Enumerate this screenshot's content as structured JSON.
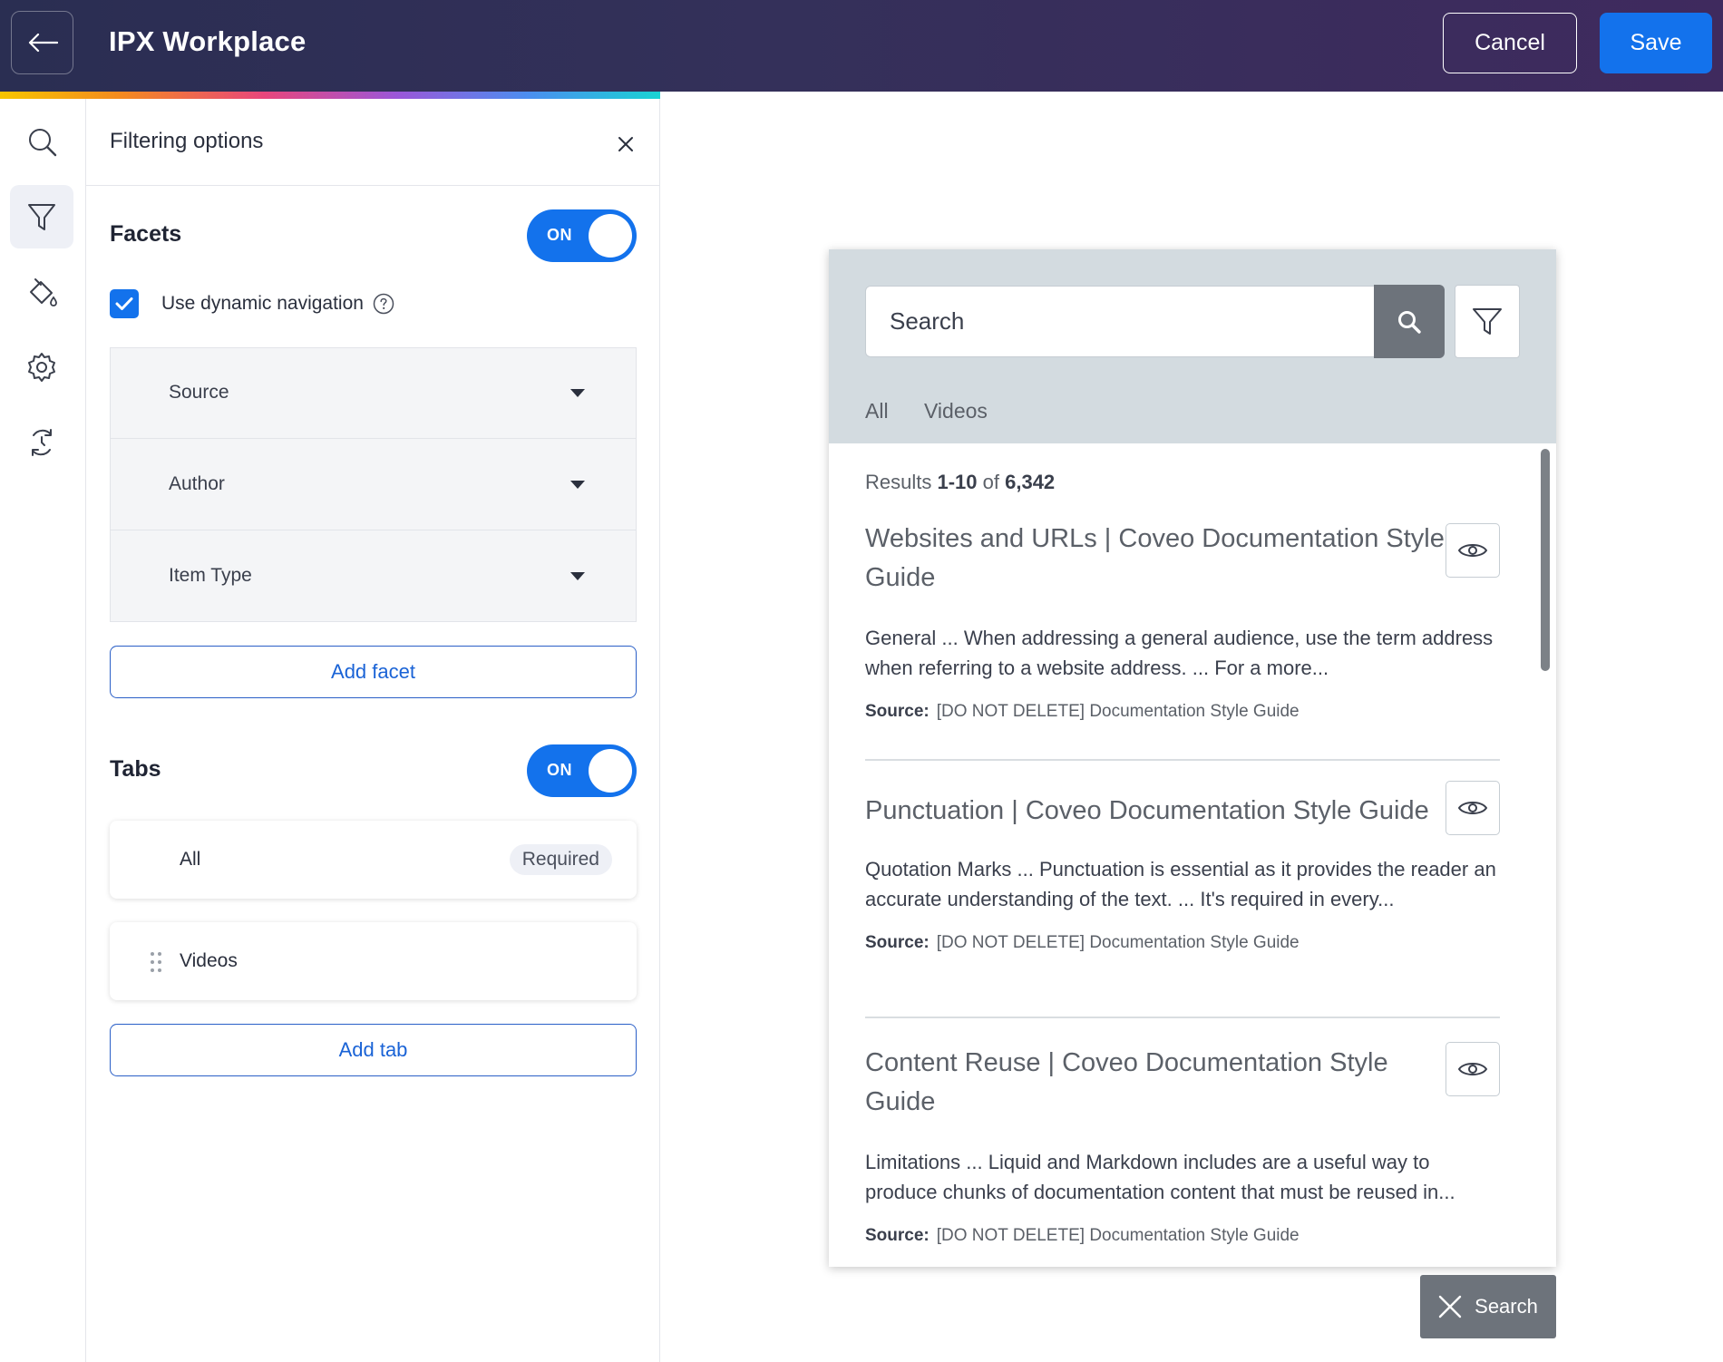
{
  "header": {
    "title": "IPX Workplace",
    "cancel_label": "Cancel",
    "save_label": "Save"
  },
  "colors": {
    "header_bg": "#2a2e52",
    "accent": "#1372ec",
    "preview_header_bg": "#d3dbe0",
    "preview_button_bg": "#6d737b"
  },
  "rail": {
    "items": [
      {
        "icon": "search-icon",
        "active": false
      },
      {
        "icon": "filter-icon",
        "active": true
      },
      {
        "icon": "paint-bucket-icon",
        "active": false
      },
      {
        "icon": "gear-icon",
        "active": false
      },
      {
        "icon": "sync-icon",
        "active": false
      }
    ]
  },
  "panel": {
    "title": "Filtering options",
    "facets": {
      "label": "Facets",
      "toggle_label": "ON",
      "enabled": true,
      "dynamic_nav_label": "Use dynamic navigation",
      "dynamic_nav_checked": true,
      "items": [
        {
          "label": "Source"
        },
        {
          "label": "Author"
        },
        {
          "label": "Item Type"
        }
      ],
      "add_label": "Add facet"
    },
    "tabs": {
      "label": "Tabs",
      "toggle_label": "ON",
      "enabled": true,
      "items": [
        {
          "label": "All",
          "badge": "Required"
        },
        {
          "label": "Videos",
          "badge": ""
        }
      ],
      "add_label": "Add tab"
    }
  },
  "preview": {
    "search_placeholder": "Search",
    "tabs": [
      "All",
      "Videos"
    ],
    "summary": {
      "prefix": "Results ",
      "range": "1-10",
      "of": " of ",
      "total": "6,342"
    },
    "source_label": "Source:",
    "results": [
      {
        "title": "Websites and URLs | Coveo Documentation Style Guide",
        "excerpt": "General ... When addressing a general audience, use the term address when referring to a website address. ... For a more...",
        "source": "[DO NOT DELETE] Documentation Style Guide"
      },
      {
        "title": "Punctuation | Coveo Documentation Style Guide",
        "excerpt": "Quotation Marks ... Punctuation is essential as it provides the reader an accurate understanding of the text. ... It's required in every...",
        "source": "[DO NOT DELETE] Documentation Style Guide"
      },
      {
        "title": "Content Reuse | Coveo Documentation Style Guide",
        "excerpt": "Limitations ... Liquid and Markdown includes are a useful way to produce chunks of documentation content that must be reused in...",
        "source": "[DO NOT DELETE] Documentation Style Guide"
      }
    ],
    "close_search_label": "Search"
  }
}
